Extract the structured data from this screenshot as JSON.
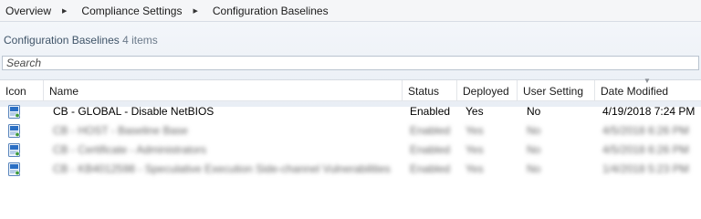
{
  "breadcrumb": [
    "Overview",
    "Compliance Settings",
    "Configuration Baselines"
  ],
  "title": {
    "text": "Configuration Baselines",
    "count": "4 items"
  },
  "search": {
    "placeholder": "Search"
  },
  "columns": [
    "Icon",
    "Name",
    "Status",
    "Deployed",
    "User Setting",
    "Date Modified"
  ],
  "sorted_column": "Date Modified",
  "rows": [
    {
      "name": "CB - GLOBAL - Disable NetBIOS",
      "status": "Enabled",
      "deployed": "Yes",
      "user_setting": "No",
      "date_modified": "4/19/2018 7:24 PM",
      "blurred": false
    },
    {
      "name": "CB - HOST - Baseline Base",
      "status": "Enabled",
      "deployed": "Yes",
      "user_setting": "No",
      "date_modified": "4/5/2018 6:26 PM",
      "blurred": true
    },
    {
      "name": "CB - Certificate - Administrators",
      "status": "Enabled",
      "deployed": "Yes",
      "user_setting": "No",
      "date_modified": "4/5/2018 6:26 PM",
      "blurred": true
    },
    {
      "name": "CB - KB4012598 - Speculative Execution Side-channel Vulnerabilities",
      "status": "Enabled",
      "deployed": "Yes",
      "user_setting": "No",
      "date_modified": "1/4/2018 5:23 PM",
      "blurred": true
    }
  ],
  "colors": {
    "accent": "#3f5468",
    "icon_blue": "#2a6fc4"
  },
  "icon_name": "configuration-baseline-icon"
}
